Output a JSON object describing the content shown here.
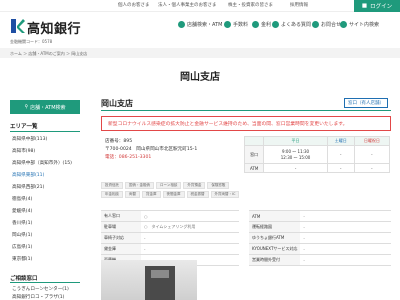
{
  "topnav": {
    "items": [
      "個人のお客さま",
      "法人・個人事業主のお客さま",
      "株主・投資家の皆さま",
      "採用情報"
    ],
    "login": "ログイン"
  },
  "header": {
    "logo": "高知銀行",
    "bank_code": "金融機関コード：0578",
    "utils": [
      "店舗検索・ATM",
      "手数料",
      "金利",
      "よくある質問",
      "お問合せ",
      "サイト内検索"
    ]
  },
  "breadcrumb": "ホーム ＞ 店舗・ATMのご案内 ＞ 岡山支店",
  "page_title": "岡山支店",
  "sidebar": {
    "search_button": "店舗・ATM検索",
    "area_heading": "エリア一覧",
    "areas": [
      {
        "label": "高知県中部(113)",
        "blue": false
      },
      {
        "label": "高知市(98)",
        "blue": false
      },
      {
        "label": "高知県中部（高知市外）(15)",
        "blue": false
      },
      {
        "label": "高知県東部(11)",
        "blue": true
      },
      {
        "label": "高知県西部(21)",
        "blue": false
      },
      {
        "label": "徳島県(4)",
        "blue": false
      },
      {
        "label": "愛媛県(4)",
        "blue": false
      },
      {
        "label": "香川県(1)",
        "blue": false
      },
      {
        "label": "岡山県(1)",
        "blue": false
      },
      {
        "label": "広島県(1)",
        "blue": false
      },
      {
        "label": "東京都(1)",
        "blue": false
      }
    ],
    "counter_heading": "ご相談窓口",
    "counters": [
      "こうぎんローンセンター(1)",
      "高知銀行ロコ・プラザ(1)"
    ]
  },
  "main": {
    "branch_name": "岡山支店",
    "tag": "窓口（有人店舗）",
    "notice": "新型コロナウイルス感染症の拡大防止と金融サービス維持のため、当面の間、窓口営業時間を変更いたします。",
    "store_no": "店番号：895",
    "address": "〒700-0024　岡山県岡山市北区駅元町15-1",
    "phone": "電話：086-251-3301",
    "hours": {
      "headers": [
        "",
        "平日",
        "土曜日",
        "日曜祝日"
      ],
      "rows": [
        {
          "label": "窓口",
          "weekday": "9:00 ～ 11:30\n12:30 ～ 15:00",
          "saturday": "-",
          "sunday": "-"
        },
        {
          "label": "ATM",
          "weekday": "-",
          "saturday": "-",
          "sunday": "-"
        }
      ]
    },
    "services_row1": [
      "投資信託",
      "国債・金融債",
      "ローン相談",
      "外貨預金",
      "保険窓販"
    ],
    "services_row2": [
      "年金相談",
      "両替",
      "貸金庫",
      "夜間金庫",
      "税金振替",
      "外貨両替・IC"
    ],
    "facility_left": [
      {
        "k": "有人窓口",
        "v": "○"
      },
      {
        "k": "駐車場",
        "v": "○　タイムシェアリング利用"
      },
      {
        "k": "車椅子対応",
        "v": "-"
      },
      {
        "k": "貸金庫",
        "v": "-"
      },
      {
        "k": "両替機",
        "v": "-"
      }
    ],
    "facility_right": [
      {
        "k": "ATM",
        "v": "-"
      },
      {
        "k": "運転経路図",
        "v": "-"
      },
      {
        "k": "ゆうちょ銀行ATM",
        "v": "-"
      },
      {
        "k": "KYOUNEXTサービス対応",
        "v": "-"
      },
      {
        "k": "営業時間外受付",
        "v": "-"
      }
    ]
  },
  "colors": {
    "brand": "#1f9a7c",
    "alert": "#e24848",
    "link": "#1f6fb2"
  }
}
